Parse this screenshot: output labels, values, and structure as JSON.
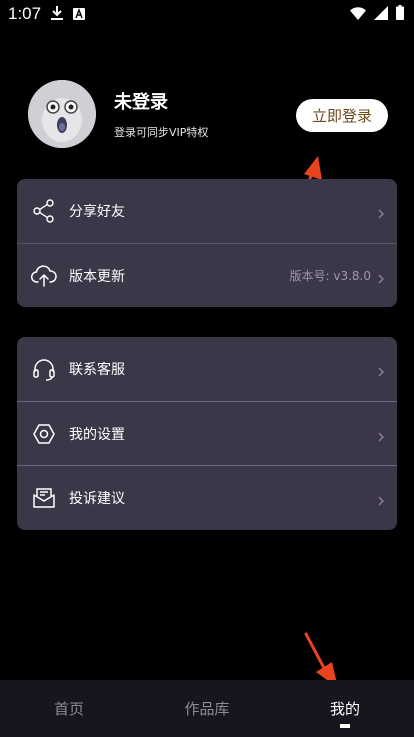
{
  "status_bar": {
    "time": "1:07",
    "icons": [
      "download-icon",
      "a-badge-icon",
      "wifi-icon",
      "signal-icon",
      "battery-icon"
    ]
  },
  "profile": {
    "name": "未登录",
    "subtitle": "登录可同步VIP特权",
    "login_button": "立即登录"
  },
  "menu_group_1": [
    {
      "label": "分享好友",
      "icon": "share-icon",
      "value": ""
    },
    {
      "label": "版本更新",
      "icon": "cloud-upload-icon",
      "value": "版本号: v3.8.0"
    }
  ],
  "menu_group_2": [
    {
      "label": "联系客服",
      "icon": "headset-icon",
      "value": ""
    },
    {
      "label": "我的设置",
      "icon": "settings-hexagon-icon",
      "value": ""
    },
    {
      "label": "投诉建议",
      "icon": "feedback-mail-icon",
      "value": ""
    }
  ],
  "bottom_nav": {
    "items": [
      "首页",
      "作品库",
      "我的"
    ],
    "active_index": 2
  },
  "colors": {
    "background": "#000000",
    "card": "#3c3748",
    "accent_arrow": "#e8431e",
    "login_text": "#6b4a1c"
  }
}
